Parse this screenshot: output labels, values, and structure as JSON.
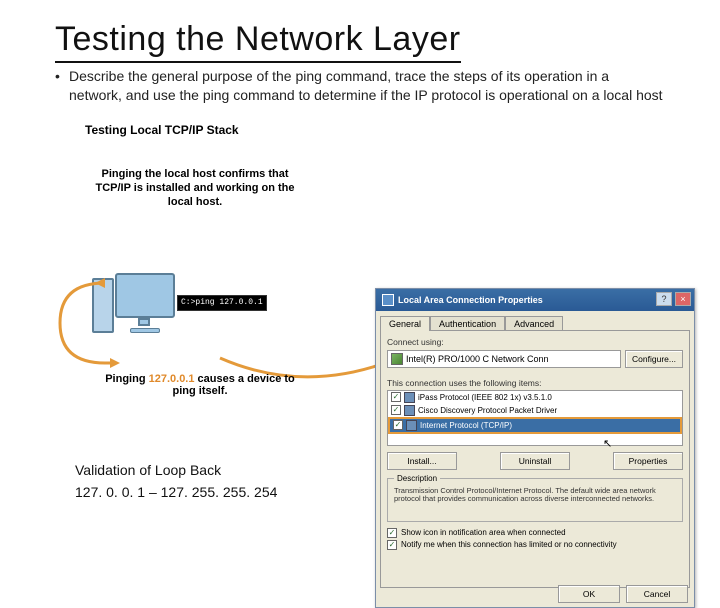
{
  "title": "Testing the Network Layer",
  "bullet": "Describe the general purpose of the ping command, trace the steps of its operation in a network, and use the ping command to determine if the IP protocol is operational on a local host",
  "left": {
    "subtitle": "Testing Local TCP/IP Stack",
    "desc1": "Pinging the local host confirms that TCP/IP is installed and working on the local host.",
    "cmd": "C:>ping 127.0.0.1",
    "desc2_pre": "Pinging ",
    "desc2_ip": "127.0.0.1",
    "desc2_post": " causes a device to ping itself."
  },
  "footer": {
    "line1": "Validation of Loop Back",
    "line2": "127. 0. 0. 1 – 127. 255. 255. 254"
  },
  "dialog": {
    "title": "Local Area Connection Properties",
    "tabs": [
      "General",
      "Authentication",
      "Advanced"
    ],
    "connect_label": "Connect using:",
    "adapter": "Intel(R) PRO/1000 C Network Conn",
    "configure": "Configure...",
    "items_label": "This connection uses the following items:",
    "items": [
      "iPass Protocol (IEEE 802 1x) v3.5.1.0",
      "Cisco Discovery Protocol Packet Driver",
      "Internet Protocol (TCP/IP)"
    ],
    "install": "Install...",
    "uninstall": "Uninstall",
    "properties": "Properties",
    "desc_title": "Description",
    "desc_text": "Transmission Control Protocol/Internet Protocol. The default wide area network protocol that provides communication across diverse interconnected networks.",
    "opt1": "Show icon in notification area when connected",
    "opt2": "Notify me when this connection has limited or no connectivity",
    "ok": "OK",
    "cancel": "Cancel"
  }
}
